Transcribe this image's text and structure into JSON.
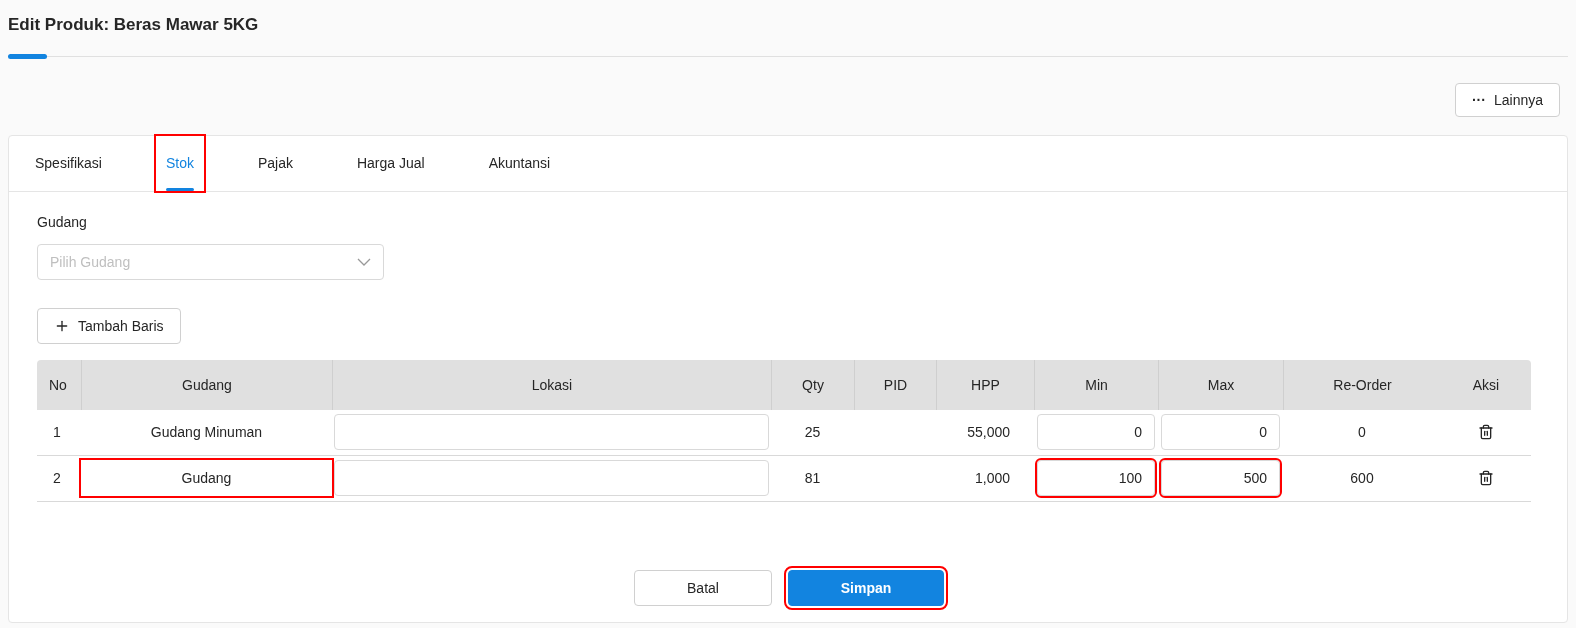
{
  "title": "Edit Produk: Beras Mawar 5KG",
  "progress": {
    "level": 0.025
  },
  "more_button": {
    "icon": "···",
    "label": "Lainnya"
  },
  "tabs": [
    {
      "label": "Spesifikasi",
      "selected": false,
      "highlighted": false
    },
    {
      "label": "Stok",
      "selected": true,
      "highlighted": true
    },
    {
      "label": "Pajak",
      "selected": false,
      "highlighted": false
    },
    {
      "label": "Harga Jual",
      "selected": false,
      "highlighted": false
    },
    {
      "label": "Akuntansi",
      "selected": false,
      "highlighted": false
    }
  ],
  "warehouse_field": {
    "label": "Gudang",
    "placeholder": "Pilih Gudang"
  },
  "add_row_button": {
    "label": "Tambah Baris"
  },
  "table": {
    "columns": [
      "No",
      "Gudang",
      "Lokasi",
      "Qty",
      "PID",
      "HPP",
      "Min",
      "Max",
      "Re-Order",
      "Aksi"
    ],
    "rows": [
      {
        "no": "1",
        "gudang": {
          "text": "Gudang Minuman",
          "highlighted": false
        },
        "qty": "25",
        "hpp": "55,000",
        "min": {
          "value": "0",
          "highlighted": false
        },
        "max": {
          "value": "0",
          "highlighted": false
        },
        "reorder": "0"
      },
      {
        "no": "2",
        "gudang": {
          "text": "Gudang",
          "highlighted": true
        },
        "qty": "81",
        "hpp": "1,000",
        "min": {
          "value": "100",
          "highlighted": true
        },
        "max": {
          "value": "500",
          "highlighted": true
        },
        "reorder": "600"
      }
    ]
  },
  "buttons": [
    {
      "kind": "secondary",
      "label": "Batal",
      "highlighted": false
    },
    {
      "kind": "primary",
      "label": "Simpan",
      "highlighted": true
    }
  ]
}
